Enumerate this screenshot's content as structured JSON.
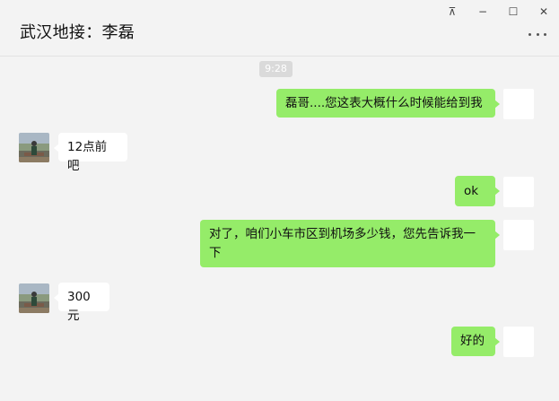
{
  "window": {
    "title": "武汉地接：李磊",
    "controls": {
      "pin": "⊼",
      "minimize": "−",
      "maximize": "☐",
      "close": "✕"
    }
  },
  "chat": {
    "timestamp": "9:28",
    "messages": [
      {
        "sender": "me",
        "text": "磊哥....您这表大概什么时候能给到我"
      },
      {
        "sender": "other",
        "text": "12点前吧"
      },
      {
        "sender": "me",
        "text": "ok"
      },
      {
        "sender": "me",
        "text": "对了，咱们小车市区到机场多少钱，您先告诉我一下"
      },
      {
        "sender": "other",
        "text": "300元"
      },
      {
        "sender": "me",
        "text": "好的"
      }
    ]
  },
  "colors": {
    "my_bubble": "#95ec69",
    "other_bubble": "#ffffff",
    "background": "#f3f3f3"
  }
}
